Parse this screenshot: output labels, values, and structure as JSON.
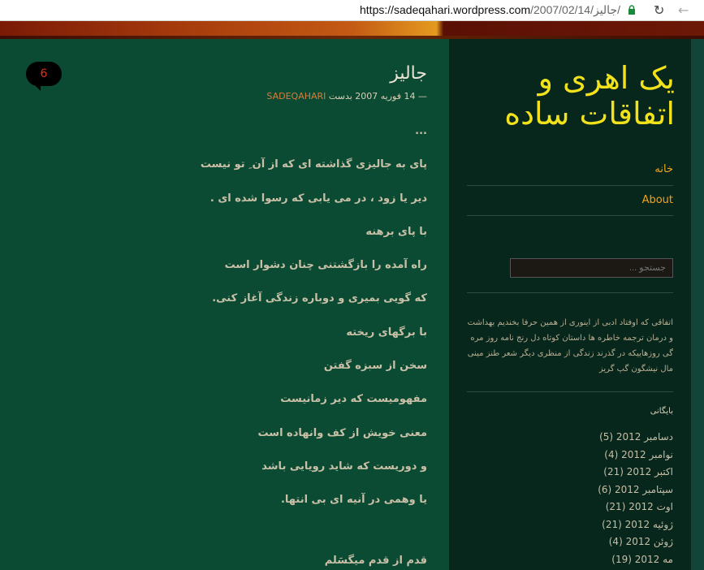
{
  "browser": {
    "url_host": "https://sadeqahari.wordpress.com",
    "url_path": "/2007/02/14/جالیز/"
  },
  "site": {
    "title": "یک اهری و اتفاقات ساده"
  },
  "nav": {
    "items": [
      "خانه",
      "About"
    ]
  },
  "search": {
    "placeholder": "جستجو ..."
  },
  "about": {
    "text": "اتفاقی که اوفتاد ادبی از اینوری از همین حرفا بخندیم بهداشت و درمان ترجمه خاطره ها داستان کوتاه دل رنج نامه روز مره گی روزهاییکه در گذرند زندگی از منظری دیگر شعر طنز مینی مال نیشگون گپ گریز"
  },
  "archive": {
    "title": "بایگانی",
    "items": [
      "دسامبر 2012 (5)",
      "نوامبر 2012 (4)",
      "اکتبر 2012 (21)",
      "سپتامبر 2012 (6)",
      "اوت 2012 (21)",
      "ژوئیه 2012 (21)",
      "ژوئن 2012 (4)",
      "مه 2012 (19)"
    ]
  },
  "post": {
    "title": "جالیز",
    "meta_prefix": "— 14 فوریه 2007 بدست",
    "author": "SADEQAHARI",
    "comments": "6",
    "lines": [
      "...",
      "پای به جالیزی گذاشته ای که از آن ِ تو نیست",
      "دیر یا زود ، در می یابی که رسوا شده ای .",
      "با پای برهنه",
      "راه آمده را بازگشتنی چنان دشوار است",
      "که گویی بمیری و دوباره زندگی آغاز کنی.",
      "با برگهای ریخته",
      "سخن از سبزه گفتن",
      "مفهومیست که دیر زمانیست",
      "معنی خویش از کف وانهاده است",
      "و دوریست که شاید رویایی باشد",
      "یا وهمی در آنیه ای بی انتها."
    ],
    "last_line": "قدم از قدم میگسَلم"
  }
}
